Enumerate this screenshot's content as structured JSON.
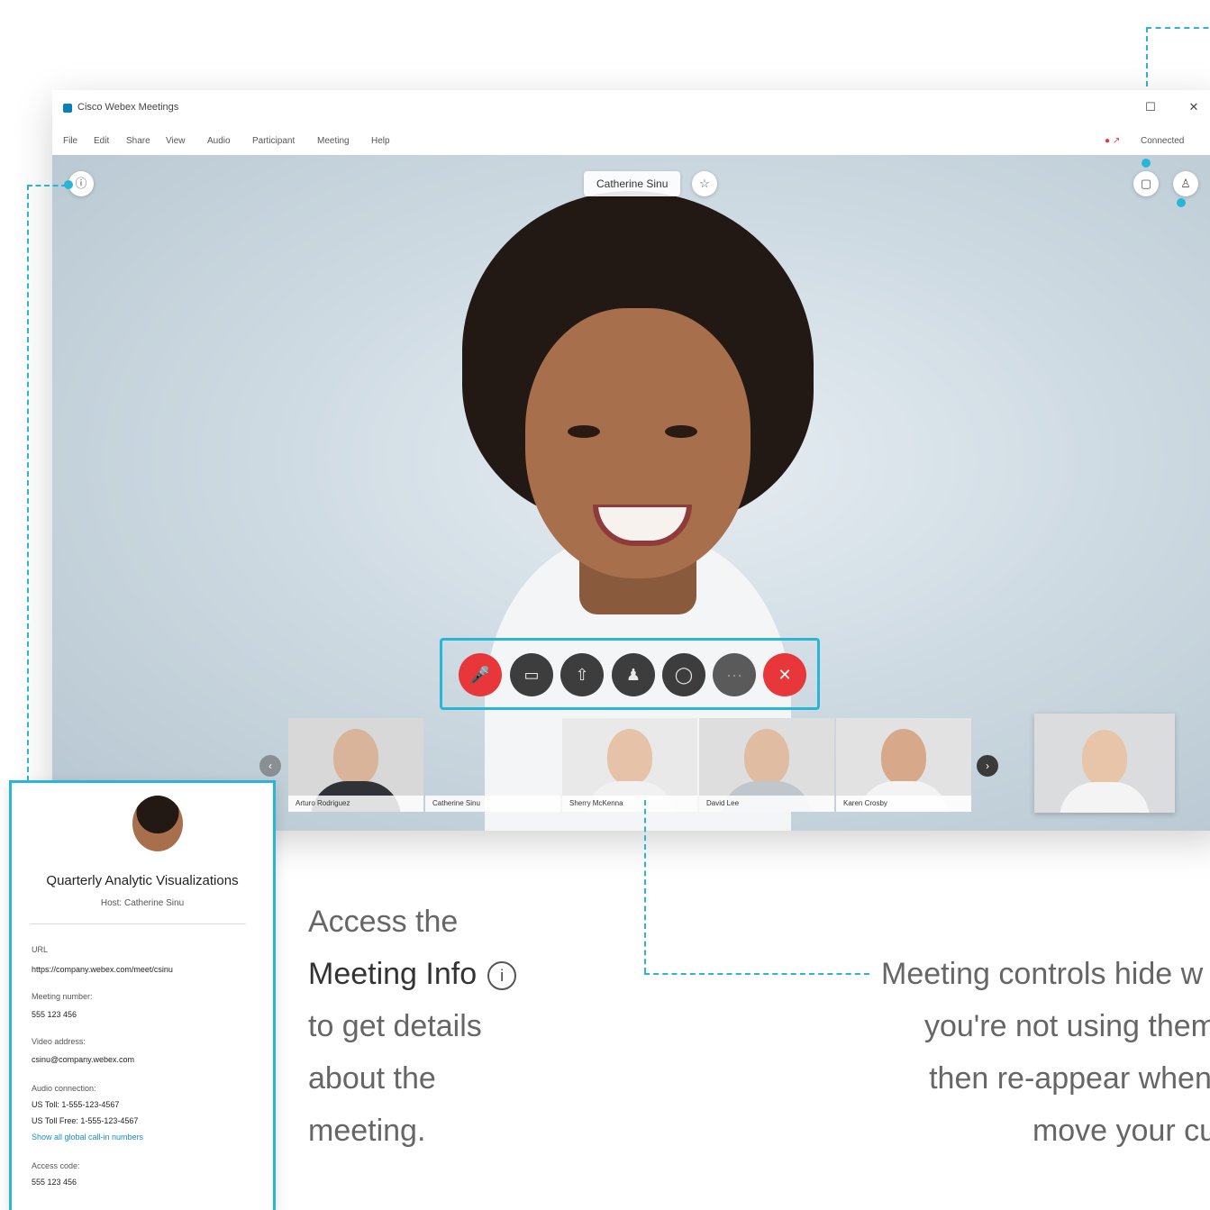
{
  "window": {
    "title": "Cisco Webex Meetings",
    "controls": [
      "☐",
      "✕"
    ]
  },
  "menu": {
    "items": [
      "File",
      "Edit",
      "Share",
      "View",
      "Audio",
      "Participant",
      "Meeting",
      "Help"
    ],
    "right": "Connected"
  },
  "video": {
    "active_speaker": "Catherine Sinu"
  },
  "controls": {
    "buttons": [
      {
        "name": "mute",
        "glyph": "🎤",
        "color": "#e8373a"
      },
      {
        "name": "video",
        "glyph": "▭",
        "color": "#3d3d3d"
      },
      {
        "name": "share",
        "glyph": "⇧",
        "color": "#3d3d3d"
      },
      {
        "name": "participants",
        "glyph": "♟",
        "color": "#3d3d3d"
      },
      {
        "name": "chat",
        "glyph": "◯",
        "color": "#3d3d3d"
      },
      {
        "name": "more",
        "glyph": "···",
        "color": "#5a5a5a"
      },
      {
        "name": "leave",
        "glyph": "✕",
        "color": "#e8373a"
      }
    ]
  },
  "thumbnails": [
    {
      "name": "Arturo Rodriguez"
    },
    {
      "name": "Catherine Sinu"
    },
    {
      "name": "Sherry McKenna"
    },
    {
      "name": "David Lee"
    },
    {
      "name": "Karen Crosby"
    }
  ],
  "info_card": {
    "title": "Quarterly Analytic Visualizations",
    "host": "Host: Catherine Sinu",
    "url_label": "URL",
    "url_value": "https://company.webex.com/meet/csinu",
    "number_label": "Meeting number:",
    "number_value": "555 123 456",
    "video_label": "Video address:",
    "video_value": "csinu@company.webex.com",
    "audio_label": "Audio connection:",
    "audio_line1": "US Toll: 1-555-123-4567",
    "audio_line2": "US Toll Free: 1-555-123-4567",
    "audio_link": "Show all global call-in numbers",
    "access_label": "Access code:",
    "access_value": "555 123 456"
  },
  "annotations": {
    "left_line1": "Access the",
    "left_strong": "Meeting Info",
    "left_line3": "to get details",
    "left_line4": "about the",
    "left_line5": "meeting.",
    "right_line1": "Meeting controls hide w",
    "right_line2": "you're not using them",
    "right_line3": "then re-appear when",
    "right_line4": "move your cu"
  },
  "colors": {
    "accent": "#29b6d6",
    "danger": "#e8373a"
  }
}
